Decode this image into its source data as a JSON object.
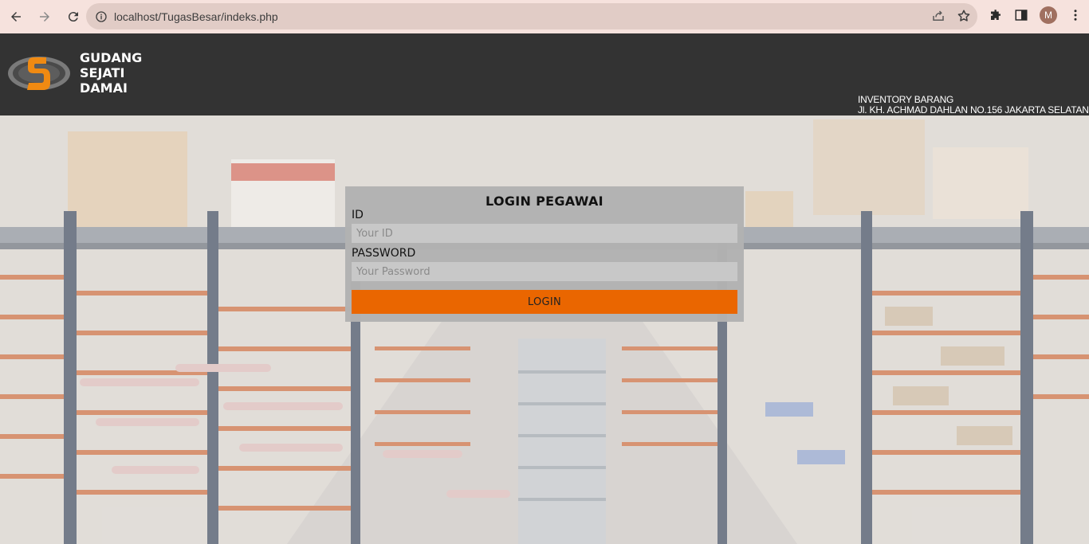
{
  "browser": {
    "url": "localhost/TugasBesar/indeks.php",
    "profile_initial": "M"
  },
  "header": {
    "brand_line1": "GUDANG",
    "brand_line2": "SEJATI",
    "brand_line3": "DAMAI",
    "address_line1": "INVENTORY BARANG",
    "address_line2": "Jl. KH. ACHMAD DAHLAN NO.156 JAKARTA SELATAN"
  },
  "login": {
    "title": "LOGIN PEGAWAI",
    "id_label": "ID",
    "id_placeholder": "Your ID",
    "password_label": "PASSWORD",
    "password_placeholder": "Your Password",
    "button_label": "LOGIN"
  },
  "colors": {
    "header_bg": "#333333",
    "button": "#ea6600",
    "chrome": "#f6e2dd"
  }
}
